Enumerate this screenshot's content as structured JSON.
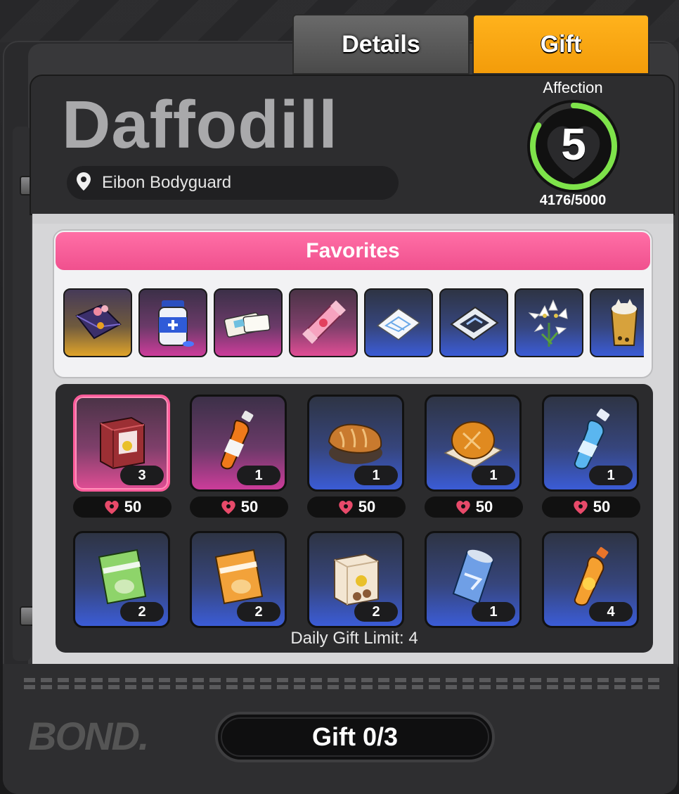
{
  "tabs": [
    {
      "label": "Details",
      "active": false
    },
    {
      "label": "Gift",
      "active": true
    }
  ],
  "character": {
    "name": "Daffodill",
    "role": "Eibon Bodyguard"
  },
  "affection": {
    "label": "Affection",
    "level": "5",
    "progress_text": "4176/5000",
    "current": 4176,
    "max": 5000,
    "ring_color": "#7ee34a"
  },
  "favorites": {
    "title": "Favorites",
    "items": [
      {
        "icon": "envelope-bouquet-icon",
        "rarity": "gold"
      },
      {
        "icon": "medicine-bottle-icon",
        "rarity": "purple"
      },
      {
        "icon": "ticket-icon",
        "rarity": "purple"
      },
      {
        "icon": "candy-wrapper-icon",
        "rarity": "pink"
      },
      {
        "icon": "map-blueprint-icon",
        "rarity": "blue"
      },
      {
        "icon": "tablet-map-icon",
        "rarity": "blue"
      },
      {
        "icon": "lily-flower-icon",
        "rarity": "blue"
      },
      {
        "icon": "bubble-tea-icon",
        "rarity": "blue"
      }
    ]
  },
  "gifts": [
    {
      "icon": "cookie-box-icon",
      "qty": "3",
      "cost": "50",
      "rarity": "pink",
      "selected": true
    },
    {
      "icon": "orange-soda-bottle-icon",
      "qty": "1",
      "cost": "50",
      "rarity": "purple",
      "selected": false
    },
    {
      "icon": "bread-loaf-icon",
      "qty": "1",
      "cost": "50",
      "rarity": "blue",
      "selected": false
    },
    {
      "icon": "bun-icon",
      "qty": "1",
      "cost": "50",
      "rarity": "blue",
      "selected": false
    },
    {
      "icon": "water-bottle-icon",
      "qty": "1",
      "cost": "50",
      "rarity": "blue",
      "selected": false
    },
    {
      "icon": "green-chips-bag-icon",
      "qty": "2",
      "rarity": "blue"
    },
    {
      "icon": "orange-chips-bag-icon",
      "qty": "2",
      "rarity": "blue"
    },
    {
      "icon": "cookie-box-icon",
      "qty": "2",
      "rarity": "blue"
    },
    {
      "icon": "energy-drink-can-icon",
      "qty": "1",
      "rarity": "blue"
    },
    {
      "icon": "orange-juice-bottle-icon",
      "qty": "4",
      "rarity": "blue"
    }
  ],
  "daily_limit": "Daily Gift Limit: 4",
  "gift_button": "Gift 0/3",
  "brand": "BOND."
}
